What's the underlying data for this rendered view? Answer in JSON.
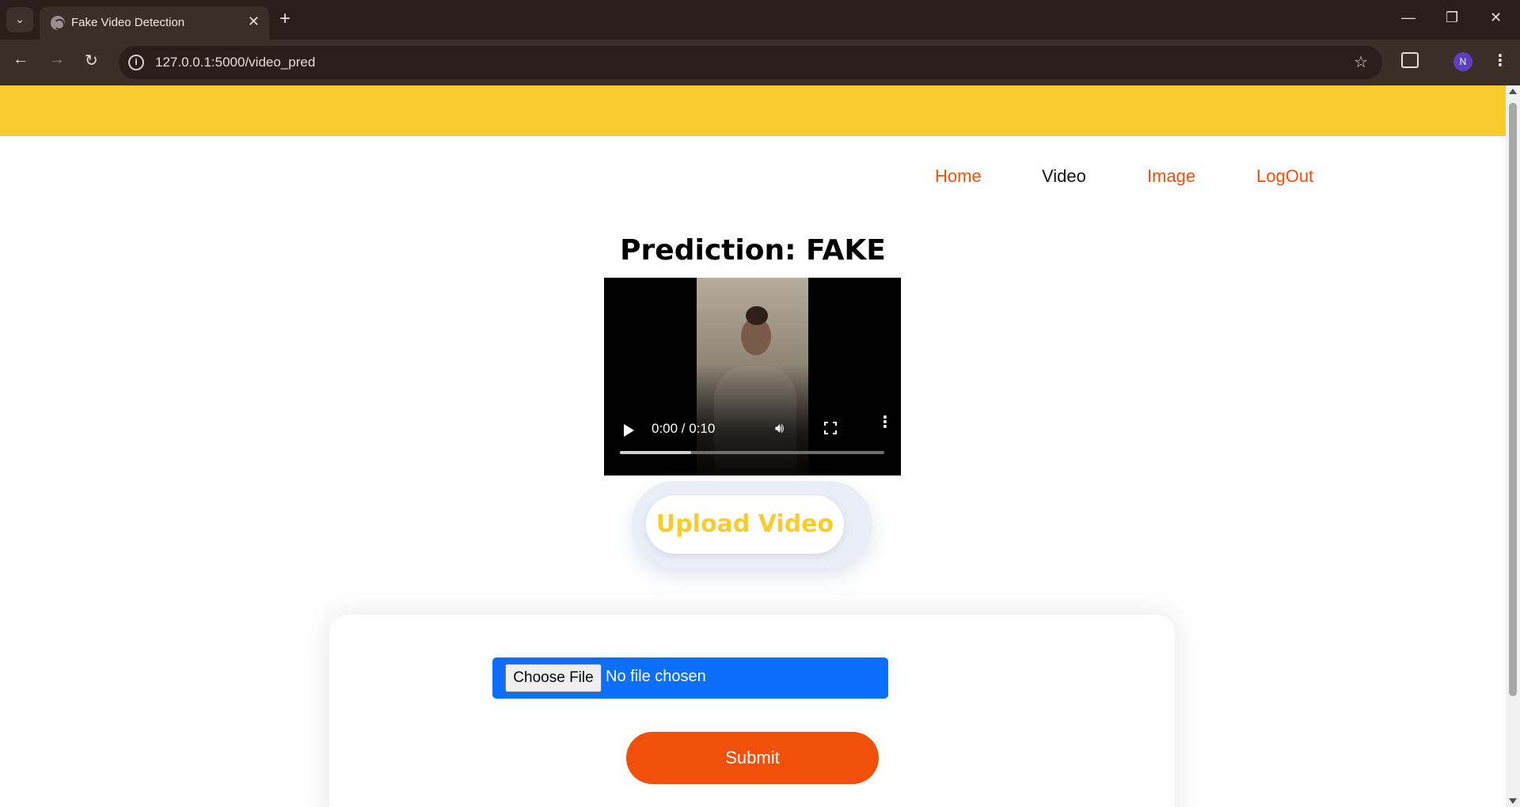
{
  "browser": {
    "tab_title": "Fake Video Detection",
    "url": "127.0.0.1:5000/video_pred",
    "avatar_initial": "N"
  },
  "nav": {
    "items": [
      {
        "label": "Home",
        "active": false
      },
      {
        "label": "Video",
        "active": true
      },
      {
        "label": "Image",
        "active": false
      },
      {
        "label": "LogOut",
        "active": false
      }
    ]
  },
  "main": {
    "prediction": "Prediction: FAKE",
    "video": {
      "time": "0:00 / 0:10",
      "buffered_fraction": 0.27
    },
    "upload_label": "Upload Video"
  },
  "form": {
    "choose_file_label": "Choose File",
    "file_status": "No file chosen",
    "submit_label": "Submit"
  },
  "colors": {
    "brand_yellow": "#f8cb2e",
    "nav_link": "#e8520e",
    "submit": "#f05009",
    "file_input": "#0d6efd"
  }
}
